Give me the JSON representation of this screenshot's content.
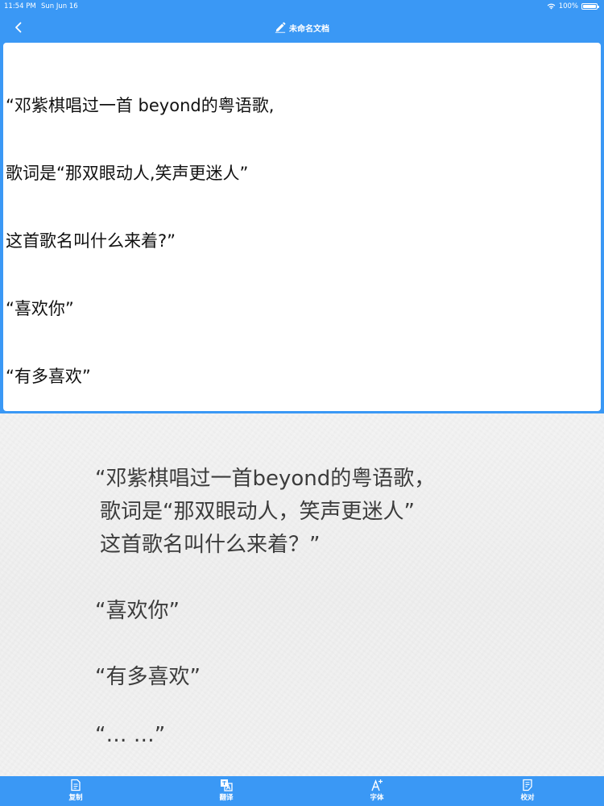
{
  "status_bar": {
    "time": "11:54 PM",
    "date": "Sun Jun 16",
    "battery": "100%",
    "battery_level": 1.0
  },
  "nav": {
    "back_icon": "chevron-left-icon",
    "title_icon": "edit-icon",
    "title": "未命名文档"
  },
  "editor": {
    "lines": [
      "“邓紫棋唱过一首 beyond的粤语歌,",
      "歌词是“那双眼动人,笑声更迷人”",
      "这首歌名叫什么来着?”",
      "“喜欢你”",
      "“有多喜欢”"
    ]
  },
  "photo": {
    "lines": [
      "“邓紫棋唱过一首beyond的粤语歌，",
      "歌词是“那双眼动人，笑声更迷人”",
      "这首歌名叫什么来着？”",
      "“喜欢你”",
      "“有多喜欢”",
      "“… …”"
    ]
  },
  "toolbar": {
    "items": [
      {
        "label": "复制",
        "icon": "copy-icon"
      },
      {
        "label": "翻译",
        "icon": "translate-icon"
      },
      {
        "label": "字体",
        "icon": "font-icon"
      },
      {
        "label": "校对",
        "icon": "proofread-icon"
      }
    ]
  },
  "colors": {
    "accent": "#3a98f5",
    "editor_bg": "#ffffff",
    "photo_bg": "#f1f1f1",
    "photo_text": "#3c3c3c"
  }
}
